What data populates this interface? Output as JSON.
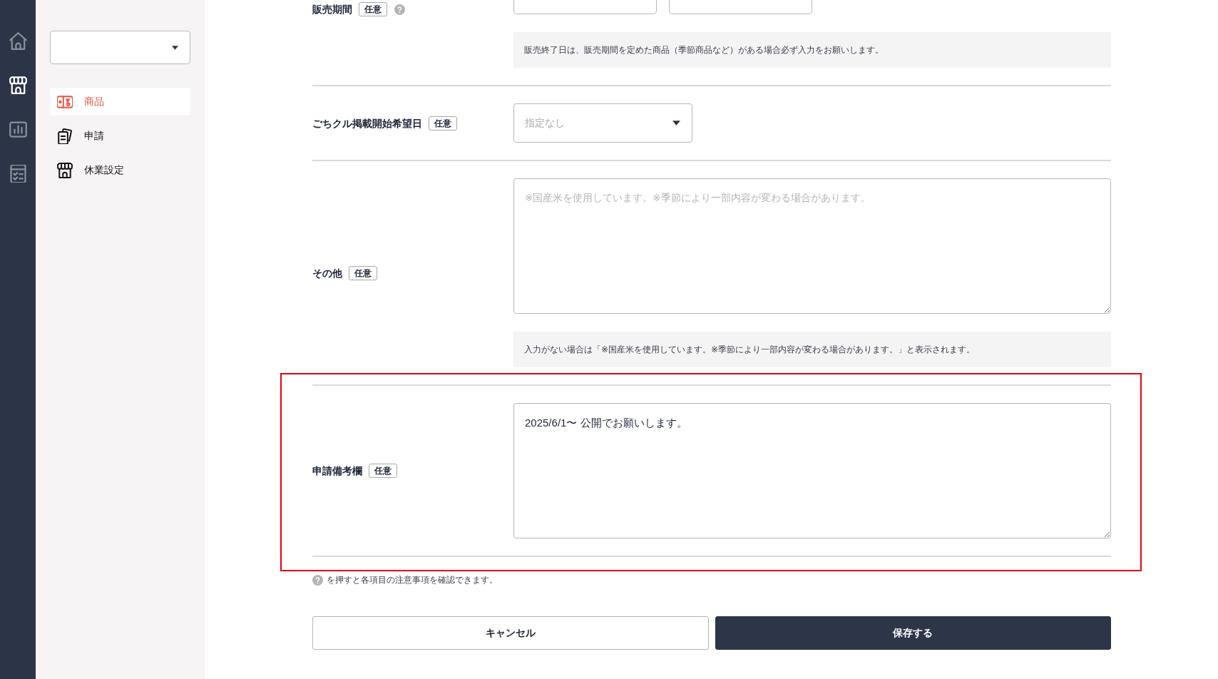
{
  "nav_rail": [
    {
      "kind": "home",
      "selected": false
    },
    {
      "kind": "store",
      "selected": true
    },
    {
      "kind": "chart",
      "selected": false
    },
    {
      "kind": "checklist",
      "selected": false
    }
  ],
  "sidebar": {
    "items": [
      {
        "kind": "product",
        "label": "商品",
        "selected": true
      },
      {
        "kind": "application",
        "label": "申請",
        "selected": false
      },
      {
        "kind": "store",
        "label": "休業設定",
        "selected": false
      }
    ]
  },
  "form": {
    "rows": [
      {
        "kind": "date_range",
        "label": "販売期間",
        "badge": "任意",
        "help": true,
        "highlighted": false,
        "note": "販売終了日は、販売期間を定めた商品（季節商品など）がある場合必ず入力をお願いします。"
      },
      {
        "kind": "select",
        "label": "ごちクル掲載開始希望日",
        "badge": "任意",
        "help": false,
        "highlighted": false,
        "placeholder": "指定なし"
      },
      {
        "kind": "textarea",
        "label": "その他",
        "badge": "任意",
        "help": false,
        "highlighted": false,
        "placeholder": "※国産米を使用しています。※季節により一部内容が変わる場合があります。",
        "note": "入力がない場合は「※国産米を使用しています。※季節により一部内容が変わる場合があります。」と表示されます。"
      },
      {
        "kind": "textarea",
        "label": "申請備考欄",
        "badge": "任意",
        "help": false,
        "highlighted": true,
        "value": "2025/6/1〜 公開でお願いします。"
      }
    ],
    "help_note": "を押すと各項目の注意事項を確認できます。"
  },
  "buttons": [
    {
      "kind": "secondary",
      "label": "キャンセル"
    },
    {
      "kind": "primary",
      "label": "保存する"
    }
  ]
}
